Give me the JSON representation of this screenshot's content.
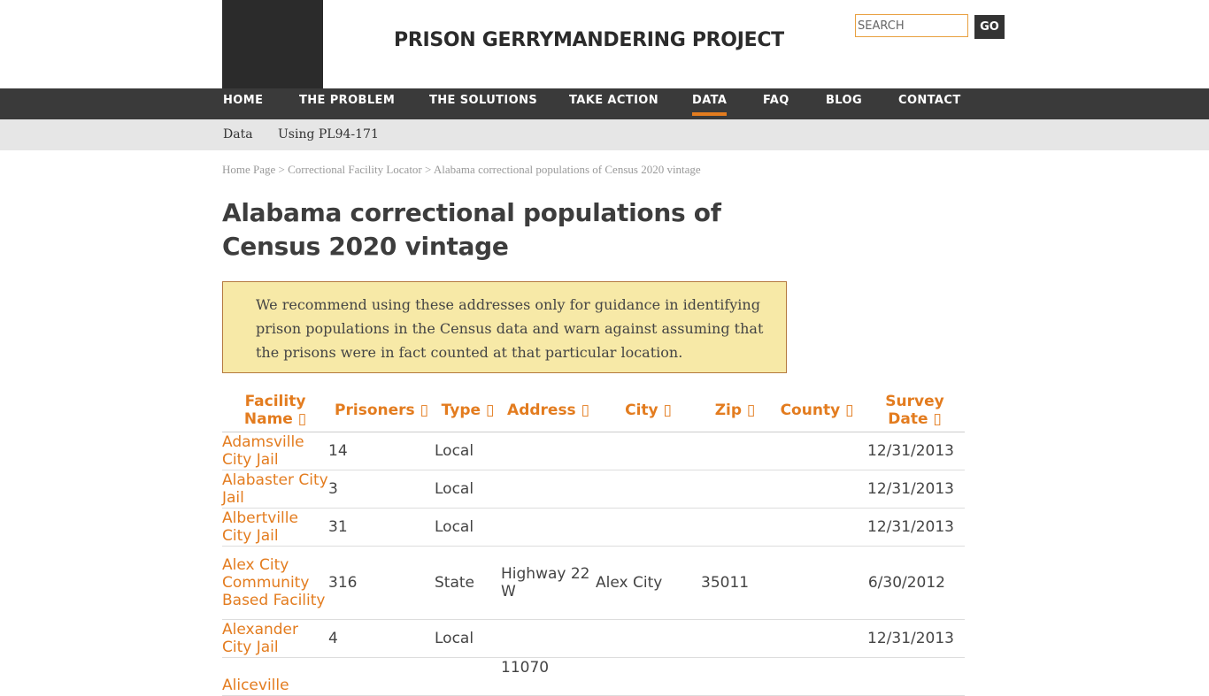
{
  "site": {
    "title": "PRISON GERRYMANDERING PROJECT"
  },
  "search": {
    "placeholder": "SEARCH",
    "button": "GO"
  },
  "nav": {
    "items": [
      {
        "label": "HOME"
      },
      {
        "label": "THE PROBLEM"
      },
      {
        "label": "THE SOLUTIONS"
      },
      {
        "label": "TAKE ACTION"
      },
      {
        "label": "DATA"
      },
      {
        "label": "FAQ"
      },
      {
        "label": "BLOG"
      },
      {
        "label": "CONTACT"
      }
    ],
    "active": "DATA"
  },
  "subnav": {
    "items": [
      {
        "label": "Data"
      },
      {
        "label": "Using PL94-171"
      }
    ]
  },
  "breadcrumb": {
    "home": "Home Page",
    "sep": " > ",
    "locator": "Correctional Facility Locator",
    "current": "Alabama correctional populations of Census 2020 vintage"
  },
  "page": {
    "title": "Alabama correctional populations of Census 2020 vintage",
    "notice": "We recommend using these addresses only for guidance in identifying prison populations in the Census data and warn against assuming that the prisons were in fact counted at that particular location."
  },
  "table": {
    "headers": {
      "facility": "Facility Name ▯",
      "prisoners": "Prisoners ▯",
      "type": "Type ▯",
      "address": "Address ▯",
      "city": "City ▯",
      "zip": "Zip ▯",
      "county": "County ▯",
      "survey": "Survey Date ▯"
    },
    "rows": [
      {
        "facility": "Adamsville City Jail",
        "prisoners": "14",
        "type": "Local",
        "address": "",
        "city": "",
        "zip": "",
        "county": "",
        "survey": "12/31/2013"
      },
      {
        "facility": "Alabaster City Jail",
        "prisoners": "3",
        "type": "Local",
        "address": "",
        "city": "",
        "zip": "",
        "county": "",
        "survey": "12/31/2013"
      },
      {
        "facility": "Albertville City Jail",
        "prisoners": "31",
        "type": "Local",
        "address": "",
        "city": "",
        "zip": "",
        "county": "",
        "survey": "12/31/2013"
      },
      {
        "facility": "Alex City Community Based Facility",
        "prisoners": "316",
        "type": "State",
        "address": "Highway 22 W",
        "city": "Alex City",
        "zip": "35011",
        "county": "",
        "survey": "6/30/2012"
      },
      {
        "facility": "Alexander City Jail",
        "prisoners": "4",
        "type": "Local",
        "address": "",
        "city": "",
        "zip": "",
        "county": "",
        "survey": "12/31/2013"
      },
      {
        "facility": "Aliceville",
        "prisoners": "",
        "type": "",
        "address": "11070",
        "city": "",
        "zip": "",
        "county": "",
        "survey": ""
      }
    ]
  },
  "colors": {
    "accent": "#e37c1f",
    "nav_bg": "#3a3a3a",
    "subnav_bg": "#e6e6e6",
    "notice_bg": "#f7e9a7"
  }
}
